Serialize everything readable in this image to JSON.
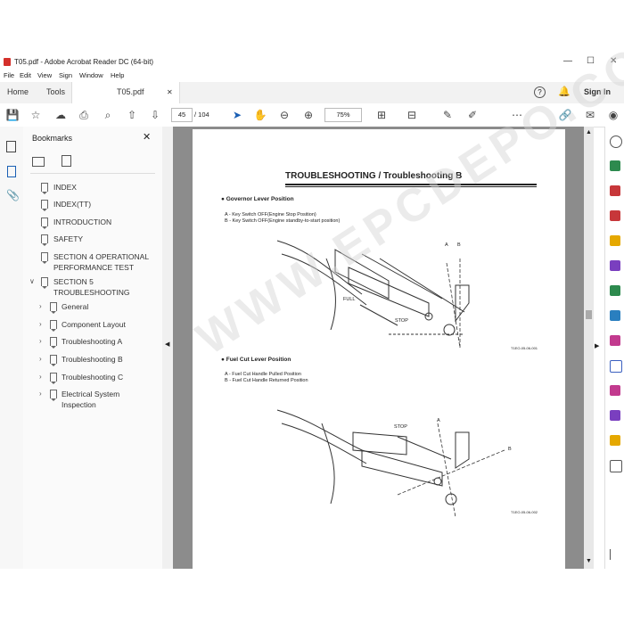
{
  "window": {
    "title": "T05.pdf - Adobe Acrobat Reader DC (64-bit)",
    "controls": [
      "—",
      "☐",
      "✕"
    ]
  },
  "menu": [
    "File",
    "Edit",
    "View",
    "Sign",
    "Window",
    "Help"
  ],
  "tabs": {
    "home": "Home",
    "tools": "Tools",
    "doc": "T05.pdf",
    "close": "✕",
    "signin": "Sign In"
  },
  "toolbar": {
    "page_current": "45",
    "page_total": "/ 104",
    "zoom": "75%"
  },
  "bookmarks": {
    "header": "Bookmarks",
    "items": [
      {
        "label": "INDEX"
      },
      {
        "label": "INDEX(TT)"
      },
      {
        "label": "INTRODUCTION"
      },
      {
        "label": "SAFETY"
      },
      {
        "label": "SECTION 4 OPERATIONAL PERFORMANCE TEST"
      },
      {
        "label": "SECTION 5 TROUBLESHOOTING"
      },
      {
        "label": "General"
      },
      {
        "label": "Component Layout"
      },
      {
        "label": "Troubleshooting A"
      },
      {
        "label": "Troubleshooting B"
      },
      {
        "label": "Troubleshooting C"
      },
      {
        "label": "Electrical System Inspection"
      }
    ]
  },
  "page": {
    "title": "TROUBLESHOOTING / Troubleshooting B",
    "section1": {
      "heading": "● Governor Lever Position",
      "a": "A -  Key Switch OFF(Engine Stop Position)",
      "b": "B -  Key Switch OFF(Engine standby-to-start position)",
      "full": "FULL",
      "stop": "STOP",
      "A": "A",
      "B": "B",
      "code": "T1EO-05-06-001"
    },
    "section2": {
      "heading": "● Fuel Cut Lever Position",
      "a": "A -  Fuel Cut Handle Pulled Position",
      "b": "B -  Fuel Cut Handle Returned Position",
      "stop": "STOP",
      "A": "A",
      "B": "B",
      "code": "T1EO-05-06-002"
    }
  },
  "watermark": "WWW.EPCDEPO.COM"
}
